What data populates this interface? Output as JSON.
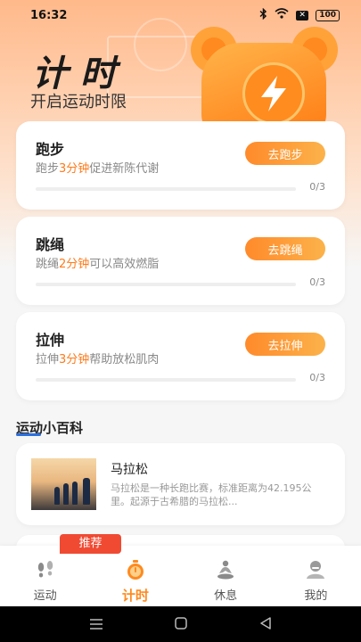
{
  "status_bar": {
    "time": "16:32",
    "battery": "100"
  },
  "header": {
    "title": "计时",
    "subtitle": "开启运动时限"
  },
  "tasks": [
    {
      "title": "跑步",
      "desc_pre": "跑步",
      "desc_hl": "3分钟",
      "desc_post": "促进新陈代谢",
      "button": "去跑步",
      "progress_text": "0/3",
      "progress": 0
    },
    {
      "title": "跳绳",
      "desc_pre": "跳绳",
      "desc_hl": "2分钟",
      "desc_post": "可以高效燃脂",
      "button": "去跳绳",
      "progress_text": "0/3",
      "progress": 0
    },
    {
      "title": "拉伸",
      "desc_pre": "拉伸",
      "desc_hl": "3分钟",
      "desc_post": "帮助放松肌肉",
      "button": "去拉伸",
      "progress_text": "0/3",
      "progress": 0
    }
  ],
  "encyclopedia": {
    "section_title": "运动小百科",
    "article": {
      "title": "马拉松",
      "body": "马拉松是一种长跑比赛，标准距离为42.195公里。起源于古希腊的马拉松..."
    },
    "badge": "推荐"
  },
  "bottom_nav": [
    {
      "label": "运动",
      "icon": "footprints-icon"
    },
    {
      "label": "计时",
      "icon": "stopwatch-icon"
    },
    {
      "label": "休息",
      "icon": "meditation-icon"
    },
    {
      "label": "我的",
      "icon": "profile-icon"
    }
  ],
  "colors": {
    "accent": "#ff8a1f",
    "highlight": "#ff7a1a",
    "badge": "#f04a33",
    "underline": "#2b6fe0"
  }
}
